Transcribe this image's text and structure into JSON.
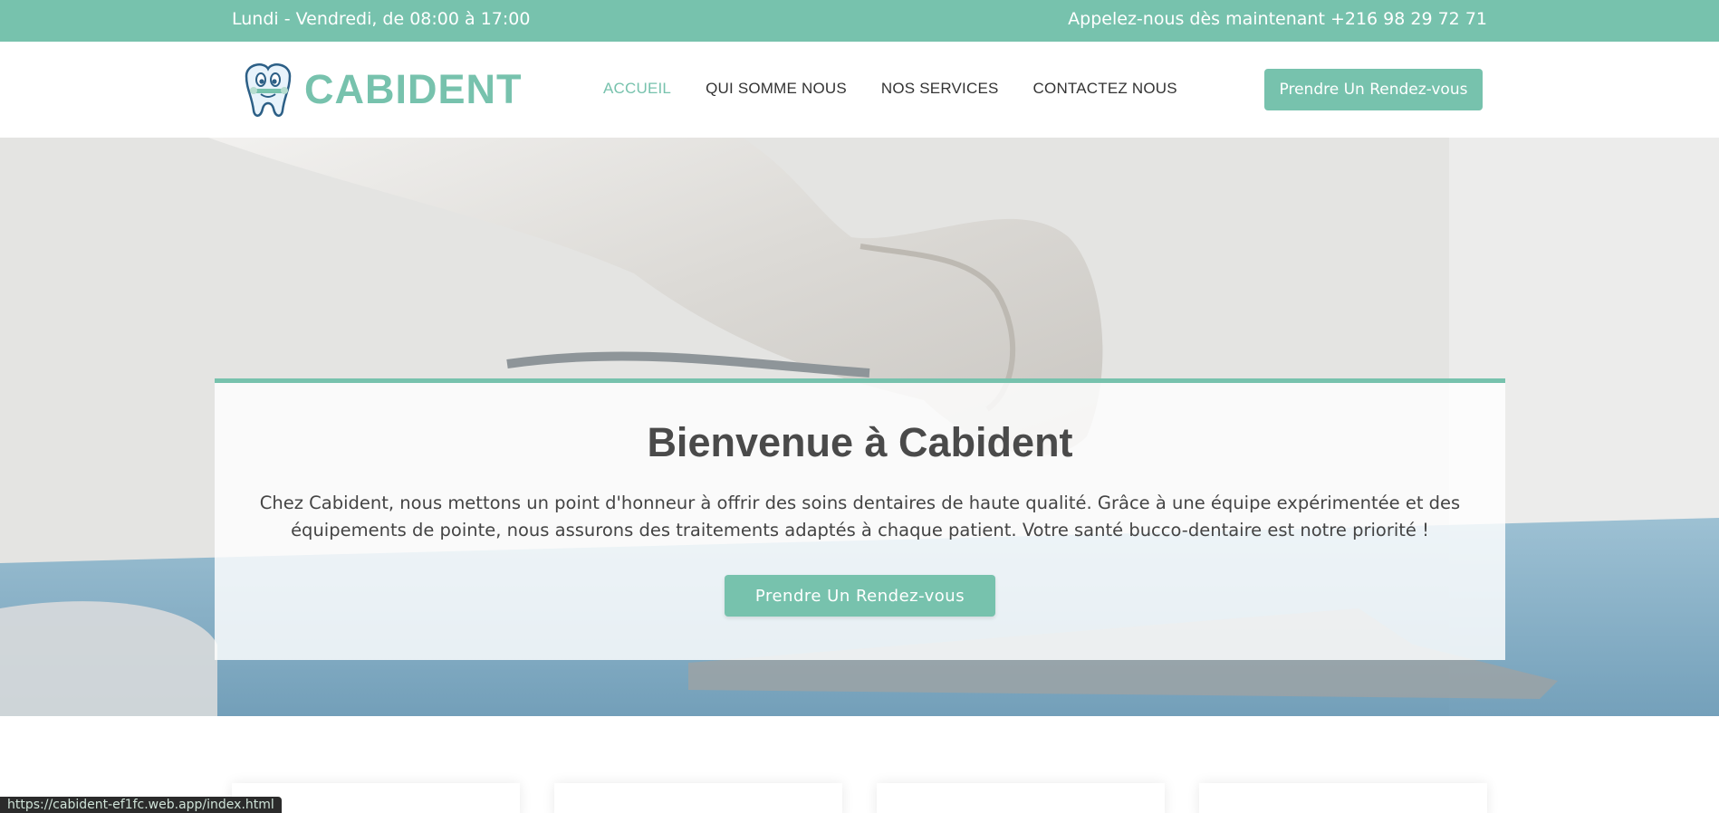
{
  "topbar": {
    "hours": "Lundi - Vendredi, de 08:00 à 17:00",
    "phone": "Appelez-nous dès maintenant +216 98 29 72 71"
  },
  "header": {
    "brand": "CABIDENT",
    "logo_icon": "tooth-mascot-icon",
    "nav": [
      {
        "label": "ACCUEIL",
        "active": true
      },
      {
        "label": "QUI SOMME NOUS",
        "active": false
      },
      {
        "label": "NOS SERVICES",
        "active": false
      },
      {
        "label": "CONTACTEZ NOUS",
        "active": false
      }
    ],
    "cta_label": "Prendre Un Rendez-vous"
  },
  "hero": {
    "title": "Bienvenue à Cabident",
    "text": "Chez Cabident, nous mettons un point d'honneur à offrir des soins dentaires de haute qualité. Grâce à une équipe expérimentée et des équipements de pointe, nous assurons des traitements adaptés à chaque patient. Votre santé bucco-dentaire est notre priorité !",
    "cta_label": "Prendre Un Rendez-vous"
  },
  "status_url": "https://cabident-ef1fc.web.app/index.html",
  "colors": {
    "accent": "#77c2ad",
    "text_dark": "#4a4a4a",
    "status_bar_bg": "#2b2b2b"
  }
}
